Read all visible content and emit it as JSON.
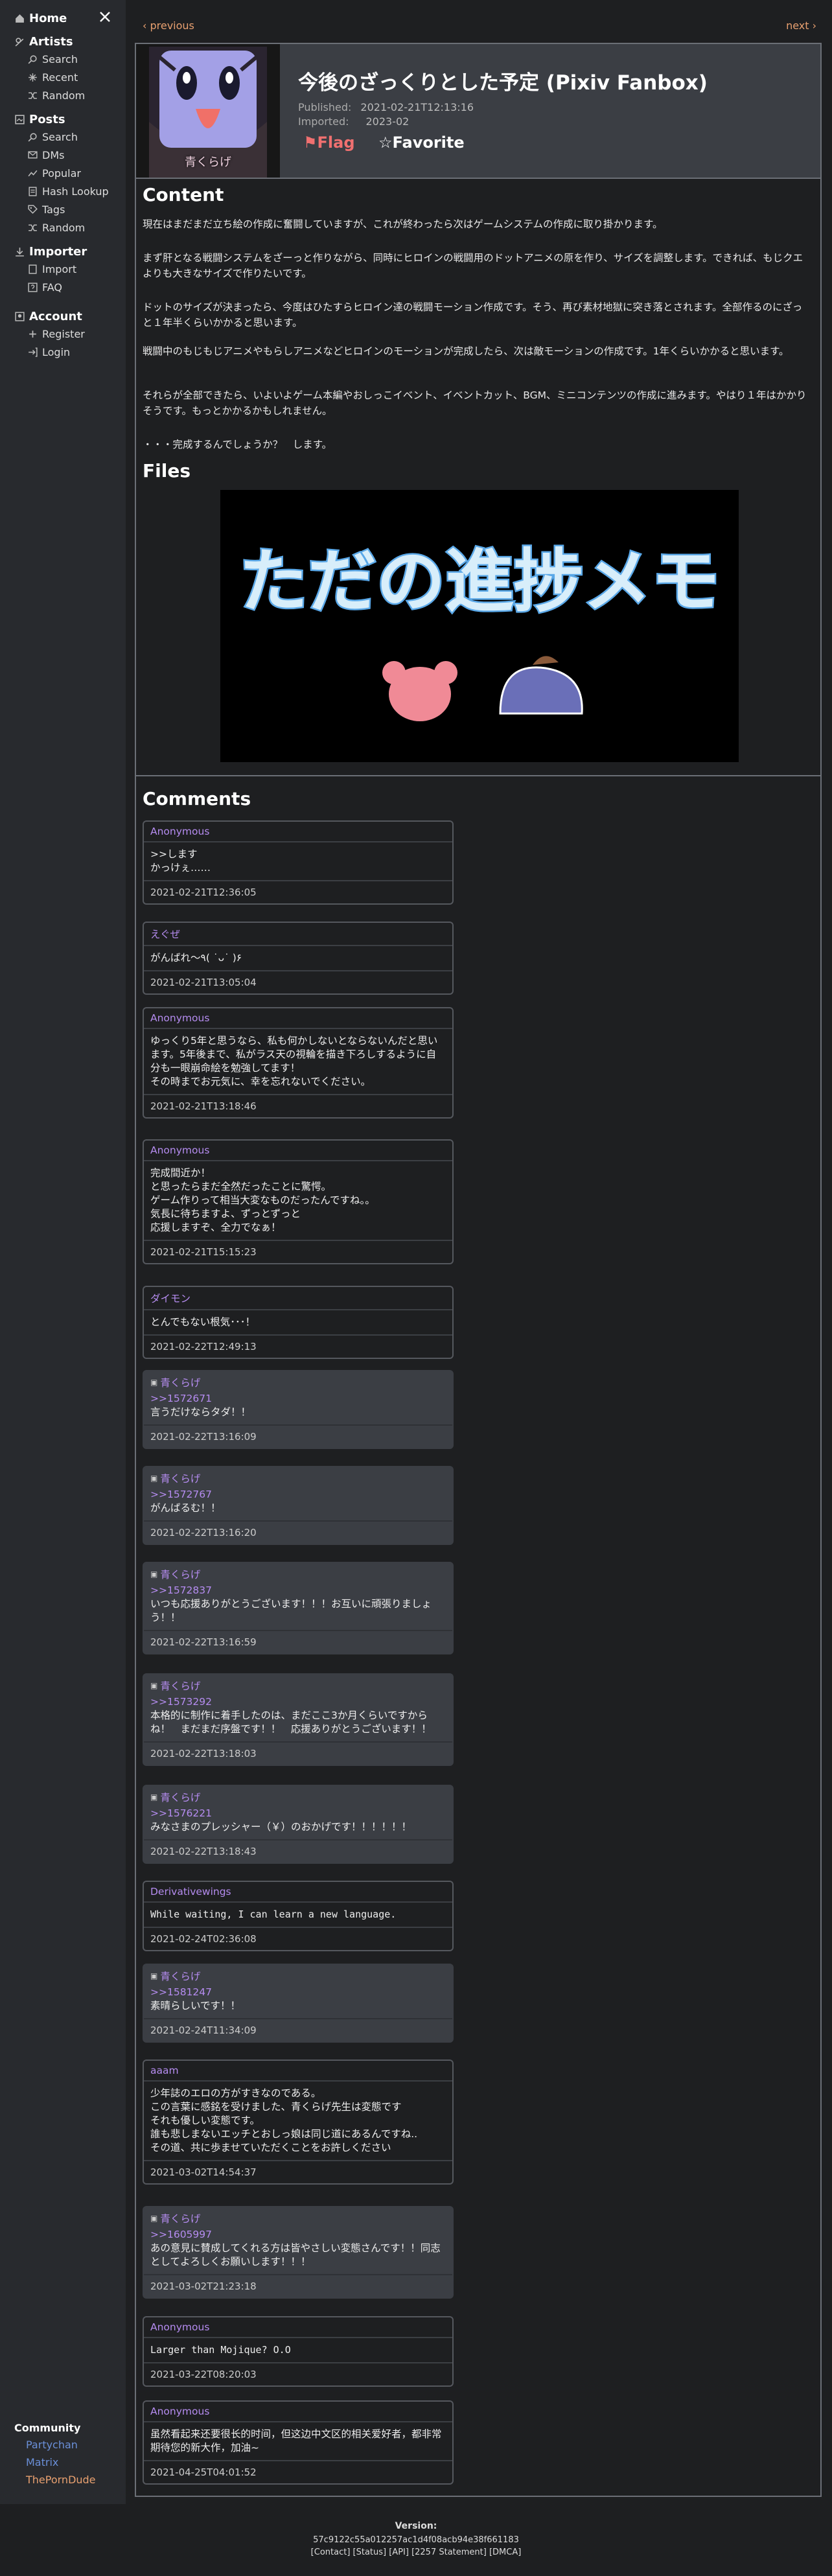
{
  "sidebar": {
    "home": "Home",
    "sections": [
      {
        "title": "Artists",
        "items": [
          "Search",
          "Recent",
          "Random"
        ]
      },
      {
        "title": "Posts",
        "items": [
          "Search",
          "DMs",
          "Popular",
          "Hash Lookup",
          "Tags",
          "Random"
        ]
      },
      {
        "title": "Importer",
        "items": [
          "Import",
          "FAQ"
        ]
      },
      {
        "title": "Account",
        "items": [
          "Register",
          "Login"
        ]
      }
    ],
    "community": {
      "title": "Community",
      "links": [
        "Partychan",
        "Matrix",
        "ThePornDude"
      ]
    }
  },
  "nav": {
    "previous": "‹ previous",
    "next": "next ›"
  },
  "post": {
    "title": "今後のざっくりとした予定 (Pixiv Fanbox)",
    "published_label": "Published:",
    "published": "2021-02-21T12:13:16",
    "imported_label": "Imported:",
    "imported": "2023-02",
    "flag": "⚑Flag",
    "favorite": "☆Favorite",
    "thumb_name": "青くらげ"
  },
  "content": {
    "heading": "Content",
    "paragraphs": [
      "現在はまだまだ立ち絵の作成に奮闘していますが、これが終わったら次はゲームシステムの作成に取り掛かります。",
      "まず肝となる戦闘システムをざーっと作りながら、同時にヒロインの戦闘用のドットアニメの原を作り、サイズを調整します。できれば、もじクエよりも大きなサイズで作りたいです。",
      "ドットのサイズが決まったら、今度はひたすらヒロイン達の戦闘モーション作成です。そう、再び素材地獄に突き落とされます。全部作るのにざっと１年半くらいかかると思います。",
      "戦闘中のもじもじアニメやもらしアニメなどヒロインのモーションが完成したら、次は敵モーションの作成です。1年くらいかかると思います。",
      "それらが全部できたら、いよいよゲーム本編やおしっこイベント、イベントカット、BGM、ミニコンテンツの作成に進みます。やはり１年はかかりそうです。もっとかかるかもしれません。",
      "・・・完成するんでしょうか？　します。"
    ]
  },
  "files": {
    "heading": "Files",
    "image_text": "ただの進捗メモ"
  },
  "comments": {
    "heading": "Comments",
    "items": [
      {
        "author": "Anonymous",
        "is_creator": false,
        "reply": "",
        "body": ">>します\nかっけぇ……",
        "date": "2021-02-21T12:36:05"
      },
      {
        "author": "えぐぜ",
        "is_creator": false,
        "reply": "",
        "body": "がんばれ〜٩( ˙ᴗ˙ )۶",
        "date": "2021-02-21T13:05:04"
      },
      {
        "author": "Anonymous",
        "is_creator": false,
        "reply": "",
        "body": "ゆっくり5年と思うなら、私も何かしないとならないんだと思います。5年後まで、私がラス天の視輪を描き下ろしするように自分も一眼崩命絵を勉強してます！\nその時までお元気に、幸を忘れないでください。",
        "date": "2021-02-21T13:18:46"
      },
      {
        "author": "Anonymous",
        "is_creator": false,
        "reply": "",
        "body": "完成間近か！\nと思ったらまだ全然だったことに驚愕。\nゲーム作りって相当大変なものだったんですね。。\n気長に待ちますよ、ずっとずっと\n応援しますぞ、全力でなぁ！",
        "date": "2021-02-21T15:15:23"
      },
      {
        "author": "ダイモン",
        "is_creator": false,
        "reply": "",
        "body": "とんでもない根気･･･！",
        "date": "2021-02-22T12:49:13"
      },
      {
        "author": "青くらげ",
        "is_creator": true,
        "reply": ">>1572671",
        "body": "言うだけならタダ！！",
        "date": "2021-02-22T13:16:09"
      },
      {
        "author": "青くらげ",
        "is_creator": true,
        "reply": ">>1572767",
        "body": "がんばるむ！！",
        "date": "2021-02-22T13:16:20"
      },
      {
        "author": "青くらげ",
        "is_creator": true,
        "reply": ">>1572837",
        "body": "いつも応援ありがとうございます！！！お互いに頑張りましょう！！",
        "date": "2021-02-22T13:16:59"
      },
      {
        "author": "青くらげ",
        "is_creator": true,
        "reply": ">>1573292",
        "body": "本格的に制作に着手したのは、まだここ3か月くらいですからね！　まだまだ序盤です！！　応援ありがとうございます！！",
        "date": "2021-02-22T13:18:03"
      },
      {
        "author": "青くらげ",
        "is_creator": true,
        "reply": ">>1576221",
        "body": "みなさまのプレッシャー（￥）のおかげです！！！！！！",
        "date": "2021-02-22T13:18:43"
      },
      {
        "author": "Derivativewings",
        "is_creator": false,
        "reply": "",
        "body": "While waiting, I can learn a new language.",
        "date": "2021-02-24T02:36:08",
        "mono": true
      },
      {
        "author": "青くらげ",
        "is_creator": true,
        "reply": ">>1581247",
        "body": "素晴らしいです！！",
        "date": "2021-02-24T11:34:09"
      },
      {
        "author": "aaam",
        "is_creator": false,
        "reply": "",
        "body": "少年誌のエロの方がすきなのである。\nこの言葉に感銘を受けました、青くらげ先生は変態です\nそれも優しい変態です。\n誰も悲しまないエッチとおしっ娘は同じ道にあるんですね..\nその道、共に歩ませていただくことをお許しください",
        "date": "2021-03-02T14:54:37"
      },
      {
        "author": "青くらげ",
        "is_creator": true,
        "reply": ">>1605997",
        "body": "あの意見に賛成してくれる方は皆やさしい変態さんです！！同志としてよろしくお願いします！！！",
        "date": "2021-03-02T21:23:18"
      },
      {
        "author": "Anonymous",
        "is_creator": false,
        "reply": "",
        "body": "Larger than Mojique? O.O",
        "date": "2021-03-22T08:20:03",
        "mono": true
      },
      {
        "author": "Anonymous",
        "is_creator": false,
        "reply": "",
        "body": "虽然看起来还要很长的时间，但这边中文区的相关爱好者，都非常期待您的新大作，加油~",
        "date": "2021-04-25T04:01:52"
      }
    ]
  },
  "footer": {
    "version_label": "Version:",
    "hash": "57c9122c55a012257ac1d4f08acb94e38f661183",
    "links": "[Contact]  [Status]  [API]  [2257 Statement]  [DMCA]"
  },
  "colors": {
    "accent": "#e8a070",
    "comment_author": "#b58cf0",
    "flag": "#f07070",
    "panel_border": "#6b6f76"
  }
}
